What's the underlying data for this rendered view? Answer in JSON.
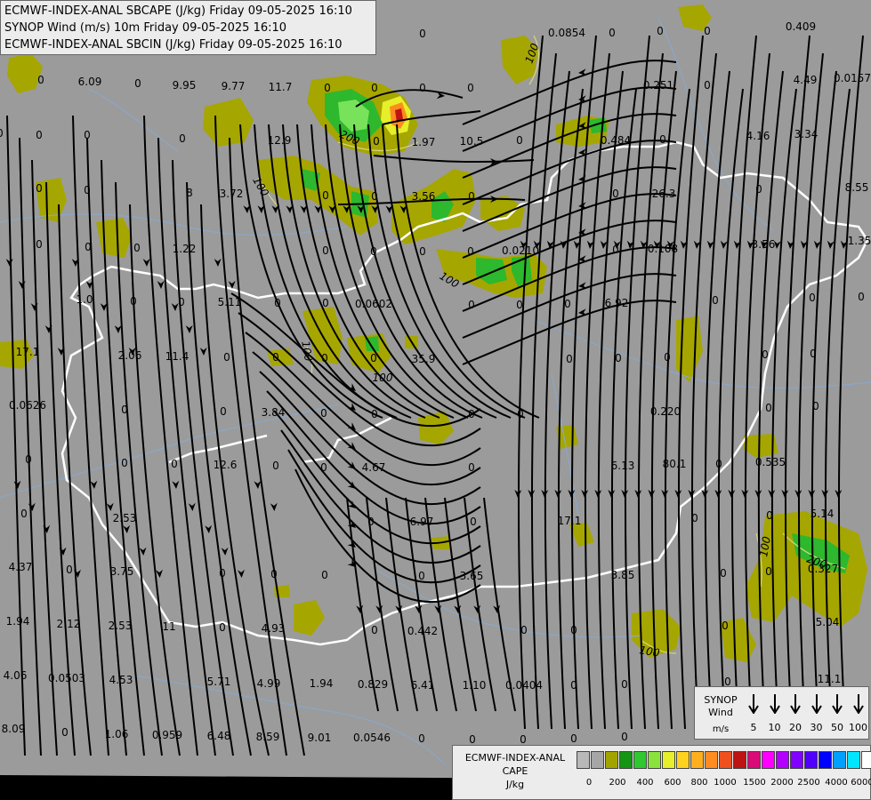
{
  "header": {
    "line1": "ECMWF-INDEX-ANAL SBCAPE (J/kg) Friday 09-05-2025 16:10",
    "line2": "SYNOP Wind (m/s) 10m Friday 09-05-2025 16:10",
    "line3": "ECMWF-INDEX-ANAL SBCIN (J/kg) Friday 09-05-2025 16:10"
  },
  "colors": {
    "background": "#9b9b9b",
    "cape_olive": "#a6a600",
    "cape_green": "#2db82d",
    "cape_bright": "#78e35a",
    "border": "#ffffff",
    "rivers": "#8aa7c8",
    "streamline": "#000000",
    "contour": "#d6d680"
  },
  "synop_legend": {
    "title": "SYNOP Wind",
    "units": "m/s",
    "speeds": [
      "5",
      "10",
      "20",
      "30",
      "50",
      "100"
    ]
  },
  "cape_legend": {
    "title": "ECMWF-INDEX-ANAL CAPE",
    "units": "J/kg",
    "ticks": [
      "0",
      "200",
      "400",
      "600",
      "800",
      "1000",
      "1500",
      "2000",
      "2500",
      "4000",
      "6000"
    ],
    "colors": [
      "#b8b8b8",
      "#a6a6a6",
      "#a3a300",
      "#149614",
      "#2fc92f",
      "#8be23c",
      "#e6ef2a",
      "#ffd21e",
      "#ffae1e",
      "#ff8c1e",
      "#f0501e",
      "#be1414",
      "#dc0a78",
      "#ff00ff",
      "#b400ff",
      "#8200ff",
      "#5000ff",
      "#0000ff",
      "#00a0ff",
      "#00e6ff",
      "#ffffff"
    ]
  },
  "contour_labels": [
    "100",
    "200",
    "100",
    "100",
    "100",
    "100",
    "100",
    "200",
    "100"
  ],
  "values": [
    "0",
    "0.0854",
    "0",
    "0",
    "0",
    "0.409",
    "0",
    "6.09",
    "0",
    "9.95",
    "9.77",
    "11.7",
    "0",
    "0",
    "0",
    "0",
    "0.251",
    "0",
    "4.49",
    "0.0157",
    "0",
    "0",
    "0",
    "0",
    "12.9",
    "0",
    "1.97",
    "10.5",
    "0",
    "0.484",
    "0",
    "4.16",
    "3.34",
    "0",
    "0",
    "8",
    "3.72",
    "0",
    "0",
    "3.56",
    "0",
    "0",
    "26.3",
    "0",
    "8.55",
    "0",
    "0",
    "0",
    "1.22",
    "0",
    "0",
    "0",
    "0",
    "0.0210",
    "0",
    "0.108",
    "3.56",
    "1.35",
    "1.0",
    "0",
    "0",
    "5.11",
    "0",
    "0",
    "0.0602",
    "0",
    "0",
    "0",
    "6.92",
    "0",
    "0",
    "0",
    "17.1",
    "2.06",
    "11.4",
    "0",
    "0",
    "0",
    "0",
    "35.9",
    "0",
    "0",
    "0",
    "0",
    "0",
    "0.0626",
    "0",
    "0",
    "3.84",
    "0",
    "0",
    "0",
    "0",
    "0.220",
    "0",
    "0",
    "0",
    "0",
    "0",
    "12.6",
    "0",
    "0",
    "4.67",
    "0",
    "6.13",
    "80.1",
    "0",
    "0.535",
    "0",
    "2.53",
    "0",
    "6.97",
    "0",
    "17.1",
    "0",
    "0",
    "5.14",
    "4.37",
    "0",
    "3.75",
    "0",
    "0",
    "0",
    "0",
    "3.65",
    "3.85",
    "0",
    "0",
    "0.327",
    "1.94",
    "2.12",
    "2.53",
    "11",
    "0",
    "4.93",
    "0",
    "0.442",
    "0",
    "0",
    "0",
    "5.04",
    "4.06",
    "0.0503",
    "4.53",
    "5.71",
    "4.99",
    "1.94",
    "0.829",
    "6.41",
    "1.10",
    "0.0404",
    "0",
    "0",
    "0",
    "11.1",
    "8.09",
    "0",
    "1.06",
    "0.959",
    "6.48",
    "8.59",
    "9.01",
    "0.0546",
    "0",
    "0",
    "0",
    "0",
    "0"
  ]
}
